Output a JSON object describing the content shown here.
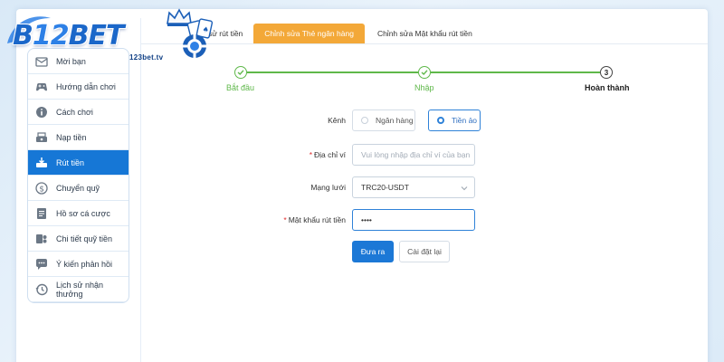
{
  "logo": {
    "brand_prefix": "B",
    "brand_number": "12",
    "brand_suffix": "BET",
    "domain": "123bet.tv"
  },
  "sidebar": {
    "items": [
      {
        "label": "Mời bạn",
        "icon": "invite-icon",
        "active": false
      },
      {
        "label": "Hướng dẫn chơi",
        "icon": "gamepad-icon",
        "active": false
      },
      {
        "label": "Cách chơi",
        "icon": "info-icon",
        "active": false
      },
      {
        "label": "Nạp tiền",
        "icon": "deposit-icon",
        "active": false
      },
      {
        "label": "Rút tiền",
        "icon": "withdraw-icon",
        "active": true
      },
      {
        "label": "Chuyển quỹ",
        "icon": "transfer-icon",
        "active": false
      },
      {
        "label": "Hồ sơ cá cược",
        "icon": "betting-record-icon",
        "active": false
      },
      {
        "label": "Chi tiết quỹ tiền",
        "icon": "fund-details-icon",
        "active": false
      },
      {
        "label": "Ý kiến phản hồi",
        "icon": "feedback-icon",
        "active": false
      },
      {
        "label": "Lịch sử nhận thưởng",
        "icon": "history-icon",
        "active": false
      }
    ]
  },
  "tabs": [
    {
      "label": "sử rút tiền",
      "active": false
    },
    {
      "label": "Chỉnh sửa Thẻ ngân hàng",
      "active": true
    },
    {
      "label": "Chỉnh sửa Mật khẩu rút tiền",
      "active": false
    }
  ],
  "steps": [
    {
      "label": "Bắt đầu",
      "state": "done"
    },
    {
      "label": "Nhập",
      "state": "done"
    },
    {
      "number": "3",
      "label": "Hoàn thành",
      "state": "current"
    }
  ],
  "form": {
    "channel_label": "Kênh",
    "channel_options": [
      {
        "label": "Ngân hàng",
        "selected": false
      },
      {
        "label": "Tiền ảo",
        "selected": true
      }
    ],
    "wallet_label": "Địa chỉ ví",
    "wallet_placeholder": "Vui lòng nhập địa chỉ ví của bạn",
    "network_label": "Mạng lưới",
    "network_value": "TRC20-USDT",
    "password_label": "Mật khẩu rút tiền",
    "password_value": "••••",
    "submit_label": "Đưa ra",
    "reset_label": "Cài đặt lại"
  },
  "colors": {
    "primary": "#1c78d6",
    "tab_active": "#f3a838",
    "step_done": "#5fb84a",
    "required": "#e02b2b"
  }
}
